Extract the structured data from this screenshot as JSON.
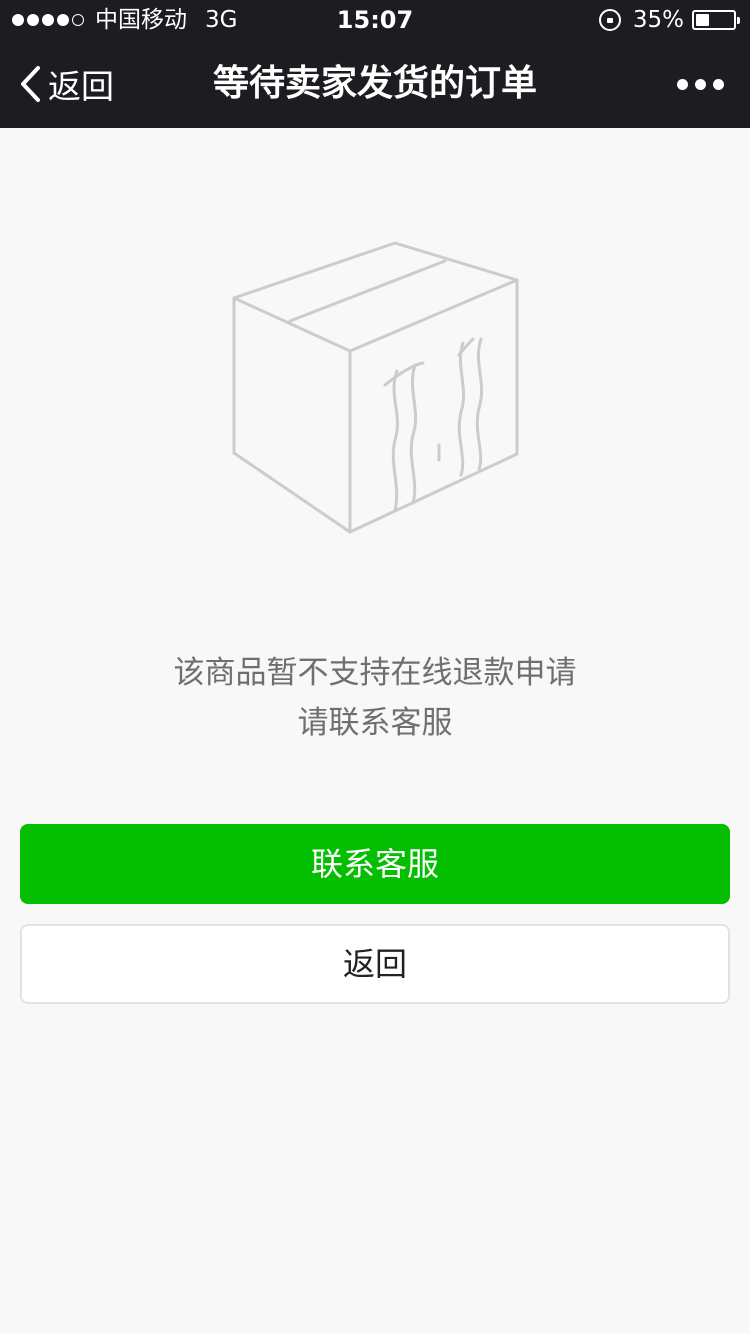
{
  "status_bar": {
    "carrier": "中国移动",
    "network": "3G",
    "time": "15:07",
    "battery": "35%",
    "battery_level": 0.35
  },
  "nav": {
    "back_label": "返回",
    "title": "等待卖家发货的订单"
  },
  "message": {
    "line1": "该商品暂不支持在线退款申请",
    "line2": "请联系客服"
  },
  "buttons": {
    "primary": "联系客服",
    "secondary": "返回"
  },
  "colors": {
    "nav_bg": "#1d1c21",
    "primary": "#04be02",
    "page_bg": "#f8f8f8"
  },
  "icons": [
    "chevron-left-icon",
    "more-icon",
    "lock-rotation-icon",
    "battery-icon",
    "empty-box-illustration"
  ]
}
